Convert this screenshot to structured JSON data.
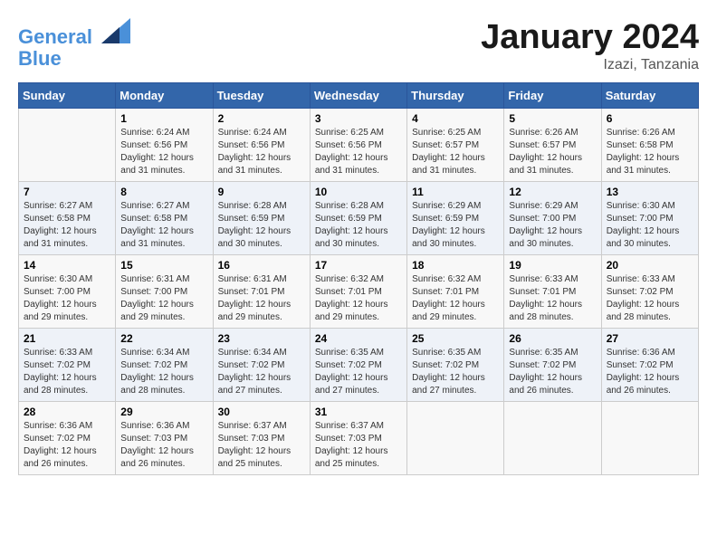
{
  "header": {
    "logo_line1": "General",
    "logo_line2": "Blue",
    "title": "January 2024",
    "subtitle": "Izazi, Tanzania"
  },
  "days_of_week": [
    "Sunday",
    "Monday",
    "Tuesday",
    "Wednesday",
    "Thursday",
    "Friday",
    "Saturday"
  ],
  "weeks": [
    [
      {
        "day": "",
        "info": ""
      },
      {
        "day": "1",
        "info": "Sunrise: 6:24 AM\nSunset: 6:56 PM\nDaylight: 12 hours and 31 minutes."
      },
      {
        "day": "2",
        "info": "Sunrise: 6:24 AM\nSunset: 6:56 PM\nDaylight: 12 hours and 31 minutes."
      },
      {
        "day": "3",
        "info": "Sunrise: 6:25 AM\nSunset: 6:56 PM\nDaylight: 12 hours and 31 minutes."
      },
      {
        "day": "4",
        "info": "Sunrise: 6:25 AM\nSunset: 6:57 PM\nDaylight: 12 hours and 31 minutes."
      },
      {
        "day": "5",
        "info": "Sunrise: 6:26 AM\nSunset: 6:57 PM\nDaylight: 12 hours and 31 minutes."
      },
      {
        "day": "6",
        "info": "Sunrise: 6:26 AM\nSunset: 6:58 PM\nDaylight: 12 hours and 31 minutes."
      }
    ],
    [
      {
        "day": "7",
        "info": "Sunrise: 6:27 AM\nSunset: 6:58 PM\nDaylight: 12 hours and 31 minutes."
      },
      {
        "day": "8",
        "info": "Sunrise: 6:27 AM\nSunset: 6:58 PM\nDaylight: 12 hours and 31 minutes."
      },
      {
        "day": "9",
        "info": "Sunrise: 6:28 AM\nSunset: 6:59 PM\nDaylight: 12 hours and 30 minutes."
      },
      {
        "day": "10",
        "info": "Sunrise: 6:28 AM\nSunset: 6:59 PM\nDaylight: 12 hours and 30 minutes."
      },
      {
        "day": "11",
        "info": "Sunrise: 6:29 AM\nSunset: 6:59 PM\nDaylight: 12 hours and 30 minutes."
      },
      {
        "day": "12",
        "info": "Sunrise: 6:29 AM\nSunset: 7:00 PM\nDaylight: 12 hours and 30 minutes."
      },
      {
        "day": "13",
        "info": "Sunrise: 6:30 AM\nSunset: 7:00 PM\nDaylight: 12 hours and 30 minutes."
      }
    ],
    [
      {
        "day": "14",
        "info": "Sunrise: 6:30 AM\nSunset: 7:00 PM\nDaylight: 12 hours and 29 minutes."
      },
      {
        "day": "15",
        "info": "Sunrise: 6:31 AM\nSunset: 7:00 PM\nDaylight: 12 hours and 29 minutes."
      },
      {
        "day": "16",
        "info": "Sunrise: 6:31 AM\nSunset: 7:01 PM\nDaylight: 12 hours and 29 minutes."
      },
      {
        "day": "17",
        "info": "Sunrise: 6:32 AM\nSunset: 7:01 PM\nDaylight: 12 hours and 29 minutes."
      },
      {
        "day": "18",
        "info": "Sunrise: 6:32 AM\nSunset: 7:01 PM\nDaylight: 12 hours and 29 minutes."
      },
      {
        "day": "19",
        "info": "Sunrise: 6:33 AM\nSunset: 7:01 PM\nDaylight: 12 hours and 28 minutes."
      },
      {
        "day": "20",
        "info": "Sunrise: 6:33 AM\nSunset: 7:02 PM\nDaylight: 12 hours and 28 minutes."
      }
    ],
    [
      {
        "day": "21",
        "info": "Sunrise: 6:33 AM\nSunset: 7:02 PM\nDaylight: 12 hours and 28 minutes."
      },
      {
        "day": "22",
        "info": "Sunrise: 6:34 AM\nSunset: 7:02 PM\nDaylight: 12 hours and 28 minutes."
      },
      {
        "day": "23",
        "info": "Sunrise: 6:34 AM\nSunset: 7:02 PM\nDaylight: 12 hours and 27 minutes."
      },
      {
        "day": "24",
        "info": "Sunrise: 6:35 AM\nSunset: 7:02 PM\nDaylight: 12 hours and 27 minutes."
      },
      {
        "day": "25",
        "info": "Sunrise: 6:35 AM\nSunset: 7:02 PM\nDaylight: 12 hours and 27 minutes."
      },
      {
        "day": "26",
        "info": "Sunrise: 6:35 AM\nSunset: 7:02 PM\nDaylight: 12 hours and 26 minutes."
      },
      {
        "day": "27",
        "info": "Sunrise: 6:36 AM\nSunset: 7:02 PM\nDaylight: 12 hours and 26 minutes."
      }
    ],
    [
      {
        "day": "28",
        "info": "Sunrise: 6:36 AM\nSunset: 7:02 PM\nDaylight: 12 hours and 26 minutes."
      },
      {
        "day": "29",
        "info": "Sunrise: 6:36 AM\nSunset: 7:03 PM\nDaylight: 12 hours and 26 minutes."
      },
      {
        "day": "30",
        "info": "Sunrise: 6:37 AM\nSunset: 7:03 PM\nDaylight: 12 hours and 25 minutes."
      },
      {
        "day": "31",
        "info": "Sunrise: 6:37 AM\nSunset: 7:03 PM\nDaylight: 12 hours and 25 minutes."
      },
      {
        "day": "",
        "info": ""
      },
      {
        "day": "",
        "info": ""
      },
      {
        "day": "",
        "info": ""
      }
    ]
  ]
}
